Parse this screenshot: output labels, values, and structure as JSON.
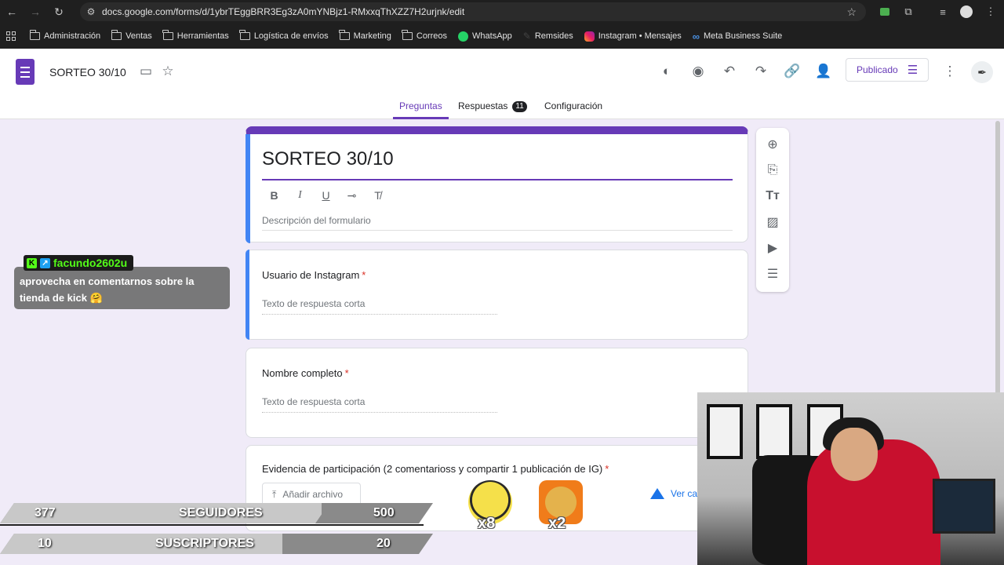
{
  "browser": {
    "url": "docs.google.com/forms/d/1ybrTEggBRR3Eg3zA0mYNBjz1-RMxxqThXZZ7H2urjnk/edit",
    "bookmarks": [
      {
        "label": "Administración",
        "icon": "folder-icon"
      },
      {
        "label": "Ventas",
        "icon": "folder-icon"
      },
      {
        "label": "Herramientas",
        "icon": "folder-icon"
      },
      {
        "label": "Logística de envíos",
        "icon": "folder-icon"
      },
      {
        "label": "Marketing",
        "icon": "folder-icon"
      },
      {
        "label": "Correos",
        "icon": "folder-icon"
      },
      {
        "label": "WhatsApp",
        "icon": "whatsapp-icon"
      },
      {
        "label": "Remsides",
        "icon": "pen-icon"
      },
      {
        "label": "Instagram • Mensajes",
        "icon": "instagram-icon"
      },
      {
        "label": "Meta Business Suite",
        "icon": "meta-icon"
      }
    ]
  },
  "header": {
    "title": "SORTEO 30/10",
    "publish_label": "Publicado",
    "tabs": [
      {
        "label": "Preguntas",
        "active": true
      },
      {
        "label": "Respuestas",
        "badge": "11"
      },
      {
        "label": "Configuración"
      }
    ]
  },
  "form": {
    "title": "SORTEO 30/10",
    "description_placeholder": "Descripción del formulario",
    "questions": [
      {
        "label": "Usuario de Instagram",
        "required_mark": "*",
        "hint": "Texto de respuesta corta"
      },
      {
        "label": "Nombre completo",
        "required_mark": "*",
        "hint": "Texto de respuesta corta"
      },
      {
        "label": "Evidencia de participación (2 comentarioss y compartir 1 publicación de IG)",
        "required_mark": "*",
        "upload_label": "Añadir archivo",
        "drive_label": "Ver ca"
      }
    ]
  },
  "overlay": {
    "chat_user": "facundo2602u",
    "chat_message": "aprovecha en comentarnos sobre la tienda de kick 🤗",
    "followers": {
      "current": "377",
      "label": "SEGUIDORES",
      "goal": "500"
    },
    "subscribers": {
      "current": "10",
      "label": "SUSCRIPTORES",
      "goal": "20"
    },
    "emote_multipliers": [
      "x8",
      "x2"
    ]
  },
  "colors": {
    "accent": "#673ab7",
    "focus": "#4285f4",
    "required": "#d93025"
  }
}
